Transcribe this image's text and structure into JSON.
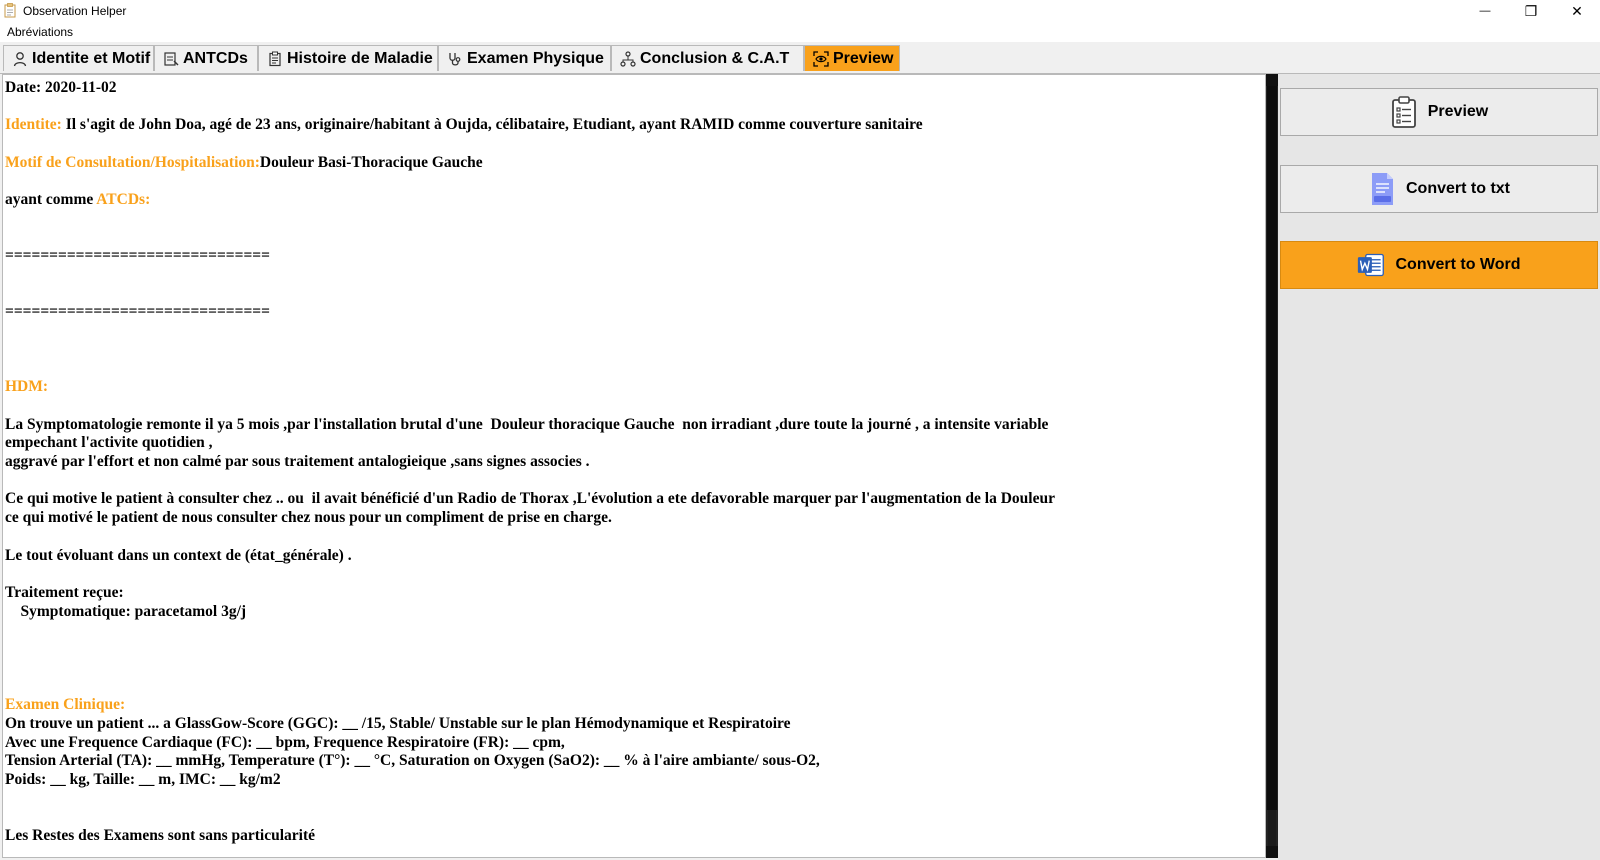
{
  "window": {
    "title": "Observation Helper",
    "minimize_glyph": "—",
    "restore_glyph": "❐",
    "close_glyph": "✕"
  },
  "menu": {
    "item_1": "Abréviations"
  },
  "tabs": [
    {
      "label": "Identite et Motif",
      "icon": "person-icon"
    },
    {
      "label": "ANTCDs",
      "icon": "history-notes-icon"
    },
    {
      "label": "Histoire de Maladie",
      "icon": "clipboard-icon"
    },
    {
      "label": "Examen Physique",
      "icon": "stethoscope-icon"
    },
    {
      "label": "Conclusion & C.A.T",
      "icon": "network-icon"
    },
    {
      "label": "Preview",
      "icon": "eye-scan-icon",
      "active": true
    }
  ],
  "doc": {
    "date": "Date: 2020-11-02",
    "identite_label": "Identite:",
    "identite_text": " Il s'agit de John Doa, agé de 23 ans, originaire/habitant à Oujda, célibataire, Etudiant, ayant RAMID comme couverture sanitaire",
    "motif_label": "Motif de Consultation/Hospitalisation:",
    "motif_text": "Douleur Basi-Thoracique Gauche",
    "atcd_prefix": "ayant comme ",
    "atcd_label": "ATCDs:",
    "separator_1": "==============================",
    "separator_2": "==============================",
    "hdm_label": "HDM:",
    "hdm_line_1": "La Symptomatologie remonte il ya 5 mois ,par l'installation brutal d'une  Douleur thoracique Gauche  non irradiant ,dure toute la journé , a intensite variable",
    "hdm_line_2": "empechant l'activite quotidien ,",
    "hdm_line_3": "aggravé par l'effort et non calmé par sous traitement antalogieique ,sans signes associes .",
    "motive_line_1": "Ce qui motive le patient à consulter chez .. ou  il avait bénéficié d'un Radio de Thorax ,L'évolution a ete defavorable marquer par l'augmentation de la Douleur",
    "motive_line_2": "ce qui motivé le patient de nous consulter chez nous pour un compliment de prise en charge.",
    "context_line": "Le tout évoluant dans un context de (état_générale) .",
    "traitement_label": "Traitement reçue:",
    "traitement_item": "    Symptomatique: paracetamol 3g/j",
    "examen_label": "Examen Clinique:",
    "examen_line_1": "On trouve un patient ... a GlassGow-Score (GGC): __ /15, Stable/ Unstable sur le plan Hémodynamique et Respiratoire",
    "examen_line_2": "Avec une Frequence Cardiaque (FC): __ bpm, Frequence Respiratoire (FR): __ cpm,",
    "examen_line_3": "Tension Arterial (TA): __ mmHg, Temperature (T°): __ °C, Saturation on Oxygen (SaO2): __ % à l'aire ambiante/ sous-O2,",
    "examen_line_4": "Poids: __ kg, Taille: __ m, IMC: __ kg/m2",
    "restes_line": "Les Restes des Examens sont sans particularité"
  },
  "actions": {
    "preview": {
      "label": "Preview",
      "icon": "clipboard-list-icon"
    },
    "txt": {
      "label": "Convert to txt",
      "icon": "txt-file-icon"
    },
    "word": {
      "label": "Convert to Word",
      "icon": "word-icon"
    }
  },
  "colors": {
    "accent": "#f9a11b",
    "text": "#000000"
  }
}
